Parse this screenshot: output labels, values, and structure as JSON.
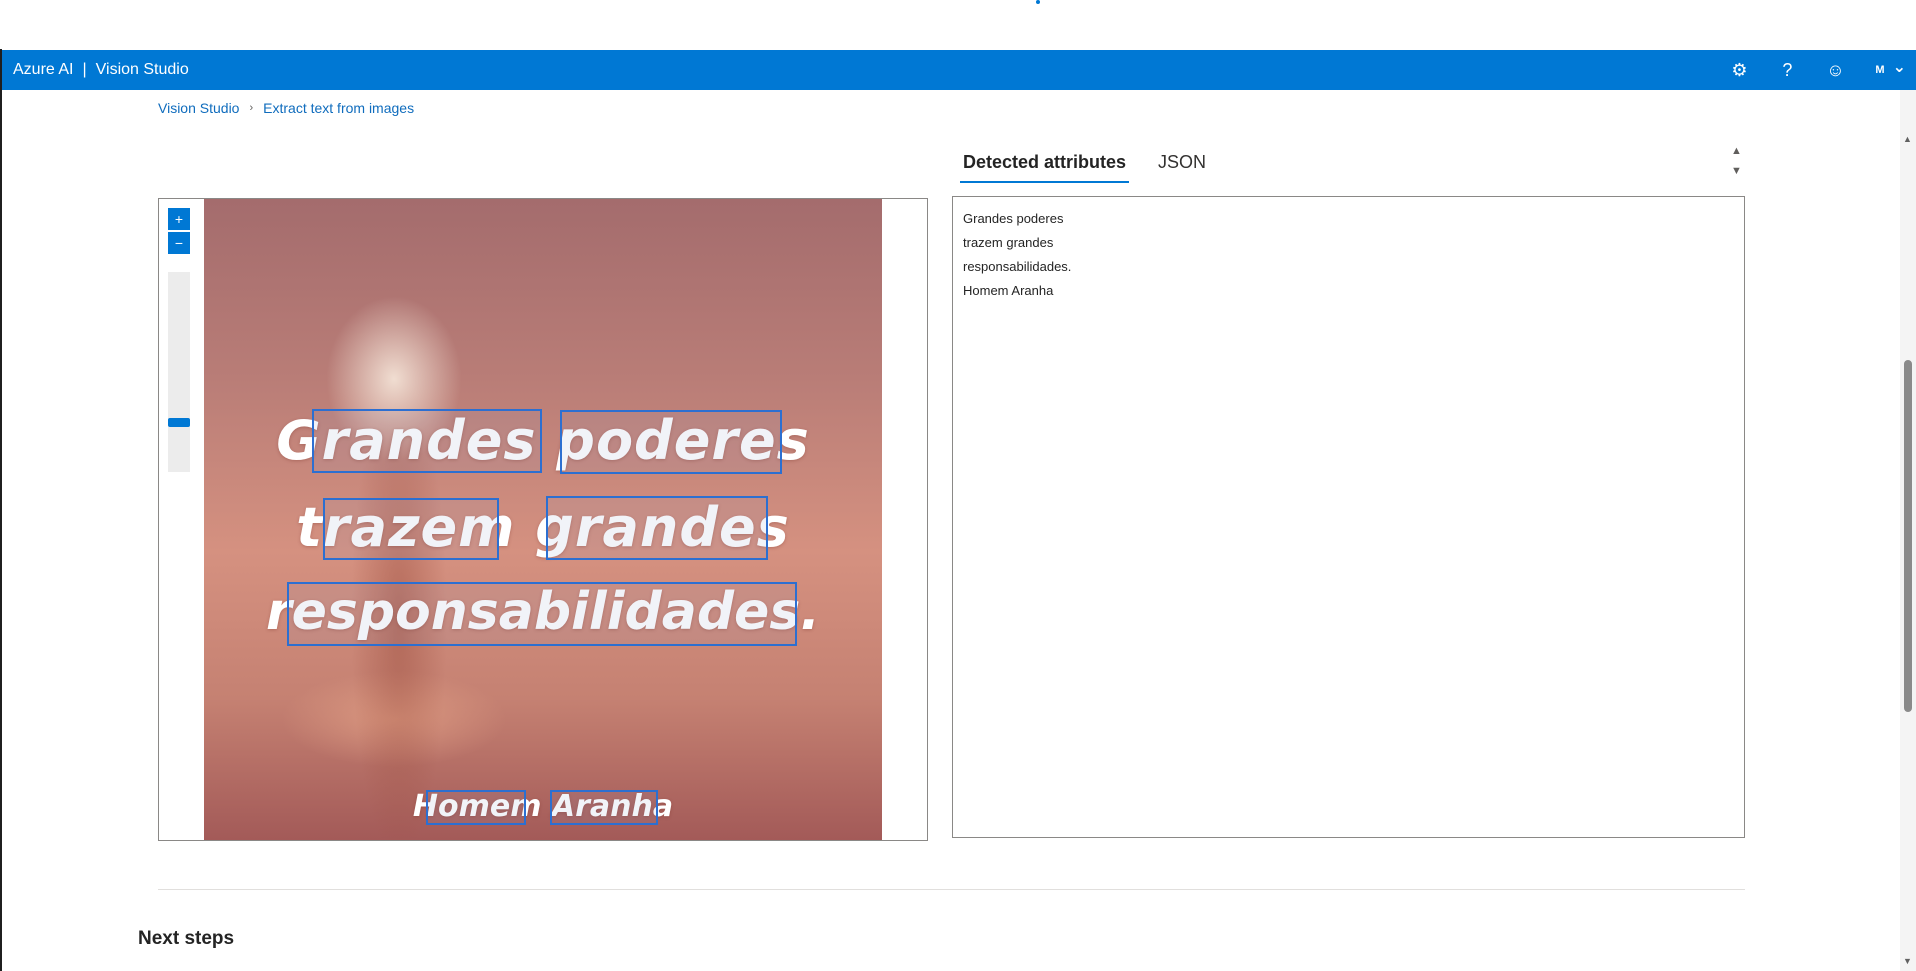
{
  "header": {
    "brand_left": "Azure AI",
    "brand_sep": "|",
    "brand_right": "Vision Studio",
    "settings_icon": "⚙",
    "help_icon": "?",
    "feedback_icon": "☺",
    "avatar_initial": "M",
    "chevron_icon": "⌄",
    "bar_color": "#0078d4"
  },
  "breadcrumb": {
    "items": [
      "Vision Studio",
      "Extract text from images"
    ],
    "separator": "›"
  },
  "image_viewer": {
    "zoom_in": "+",
    "zoom_out": "−",
    "zoom_level_fraction": 0.72,
    "image_text": {
      "line1": "Grandes poderes",
      "line2": "trazem grandes",
      "line3": "responsabilidades.",
      "line4": "Homem Aranha"
    }
  },
  "tabs": [
    {
      "label": "Detected attributes",
      "active": true
    },
    {
      "label": "JSON",
      "active": false
    }
  ],
  "results": {
    "lines": [
      "Grandes poderes",
      "trazem grandes",
      "responsabilidades.",
      "Homem Aranha"
    ]
  },
  "scroll_up": "▲",
  "scroll_down": "▼",
  "next_steps": {
    "title": "Next steps"
  }
}
